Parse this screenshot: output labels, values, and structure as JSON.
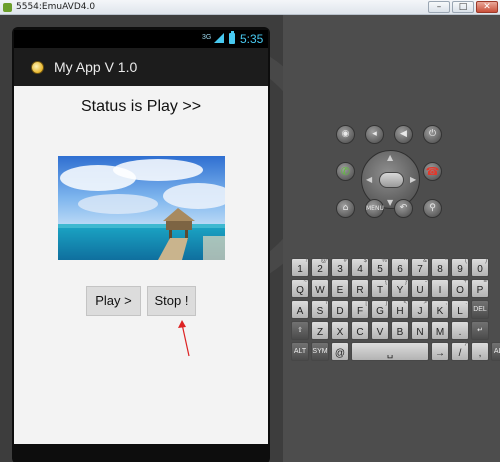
{
  "window": {
    "title": "5554:EmuAVD4.0",
    "controls": [
      "–",
      "□",
      "✕"
    ]
  },
  "statusbar": {
    "network": "3G",
    "time": "5:35"
  },
  "actionbar": {
    "title": "My App V 1.0"
  },
  "main": {
    "status_text": "Status is Play >>",
    "play_label": "Play >",
    "stop_label": "Stop !"
  },
  "controls": {
    "menu_label": "MENU",
    "top_row_icons": [
      "camera-icon",
      "volume-down-icon",
      "volume-up-icon",
      "power-icon"
    ],
    "mid_row_icons": [
      "call-icon",
      "end-call-icon"
    ],
    "bottom_row_icons": [
      "home-icon",
      "menu-icon",
      "back-icon",
      "search-icon"
    ]
  },
  "keyboard": {
    "row1": [
      {
        "k": "1",
        "s": "!"
      },
      {
        "k": "2",
        "s": "@"
      },
      {
        "k": "3",
        "s": "#"
      },
      {
        "k": "4",
        "s": "$"
      },
      {
        "k": "5",
        "s": "%"
      },
      {
        "k": "6",
        "s": "^"
      },
      {
        "k": "7",
        "s": "&"
      },
      {
        "k": "8",
        "s": "*"
      },
      {
        "k": "9",
        "s": "("
      },
      {
        "k": "0",
        "s": ")"
      }
    ],
    "row2": [
      {
        "k": "Q",
        "s": "~"
      },
      {
        "k": "W",
        "s": "\""
      },
      {
        "k": "E",
        "s": ""
      },
      {
        "k": "R",
        "s": ""
      },
      {
        "k": "T",
        "s": "{"
      },
      {
        "k": "Y",
        "s": "}"
      },
      {
        "k": "U",
        "s": "-"
      },
      {
        "k": "I",
        "s": ""
      },
      {
        "k": "O",
        "s": "+"
      },
      {
        "k": "P",
        "s": "="
      }
    ],
    "row3": [
      {
        "k": "A",
        "s": ""
      },
      {
        "k": "S",
        "s": "\\"
      },
      {
        "k": "D",
        "s": ""
      },
      {
        "k": "F",
        "s": "["
      },
      {
        "k": "G",
        "s": "]"
      },
      {
        "k": "H",
        "s": "<"
      },
      {
        "k": "J",
        "s": ">"
      },
      {
        "k": "K",
        "s": ";"
      },
      {
        "k": "L",
        "s": ":"
      },
      {
        "k": "DEL",
        "s": "",
        "dark": true
      }
    ],
    "row4": [
      {
        "k": "⇧",
        "s": "",
        "dark": true
      },
      {
        "k": "Z",
        "s": ""
      },
      {
        "k": "X",
        "s": ""
      },
      {
        "k": "C",
        "s": ""
      },
      {
        "k": "V",
        "s": ""
      },
      {
        "k": "B",
        "s": ""
      },
      {
        "k": "N",
        "s": ""
      },
      {
        "k": "M",
        "s": ""
      },
      {
        "k": ".",
        "s": ""
      },
      {
        "k": "↵",
        "s": "",
        "dark": true
      }
    ],
    "row5": [
      {
        "k": "ALT",
        "s": "",
        "dark": true
      },
      {
        "k": "SYM",
        "s": "",
        "dark": true
      },
      {
        "k": "@",
        "s": ""
      },
      {
        "k": "␣",
        "s": ""
      },
      {
        "k": "→",
        "s": ""
      },
      {
        "k": "/",
        "s": "?"
      },
      {
        "k": ",",
        "s": ""
      },
      {
        "k": "ALT",
        "s": "",
        "dark": true
      }
    ]
  }
}
